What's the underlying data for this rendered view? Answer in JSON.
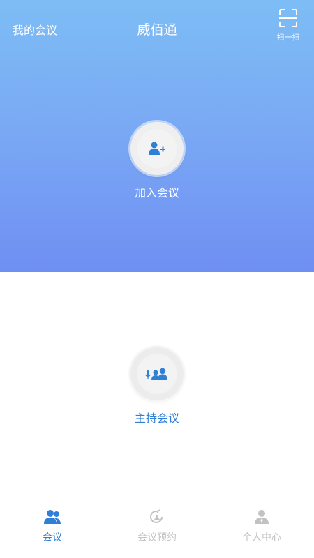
{
  "header": {
    "left_link": "我的会议",
    "title": "威佰通",
    "scan_label": "扫一扫",
    "scan_icon": "scan-icon"
  },
  "main": {
    "join": {
      "label": "加入会议",
      "icon": "add-user-icon"
    },
    "host": {
      "label": "主持会议",
      "icon": "host-meeting-icon"
    }
  },
  "tabbar": {
    "items": [
      {
        "label": "会议",
        "icon": "meeting-icon",
        "active": true
      },
      {
        "label": "会议预约",
        "icon": "schedule-icon",
        "active": false
      },
      {
        "label": "个人中心",
        "icon": "profile-icon",
        "active": false
      }
    ]
  },
  "colors": {
    "hero_top": "#7dbdf5",
    "hero_bottom": "#6f8ff3",
    "accent": "#2f7fd6",
    "inactive": "#c2c2c2"
  }
}
